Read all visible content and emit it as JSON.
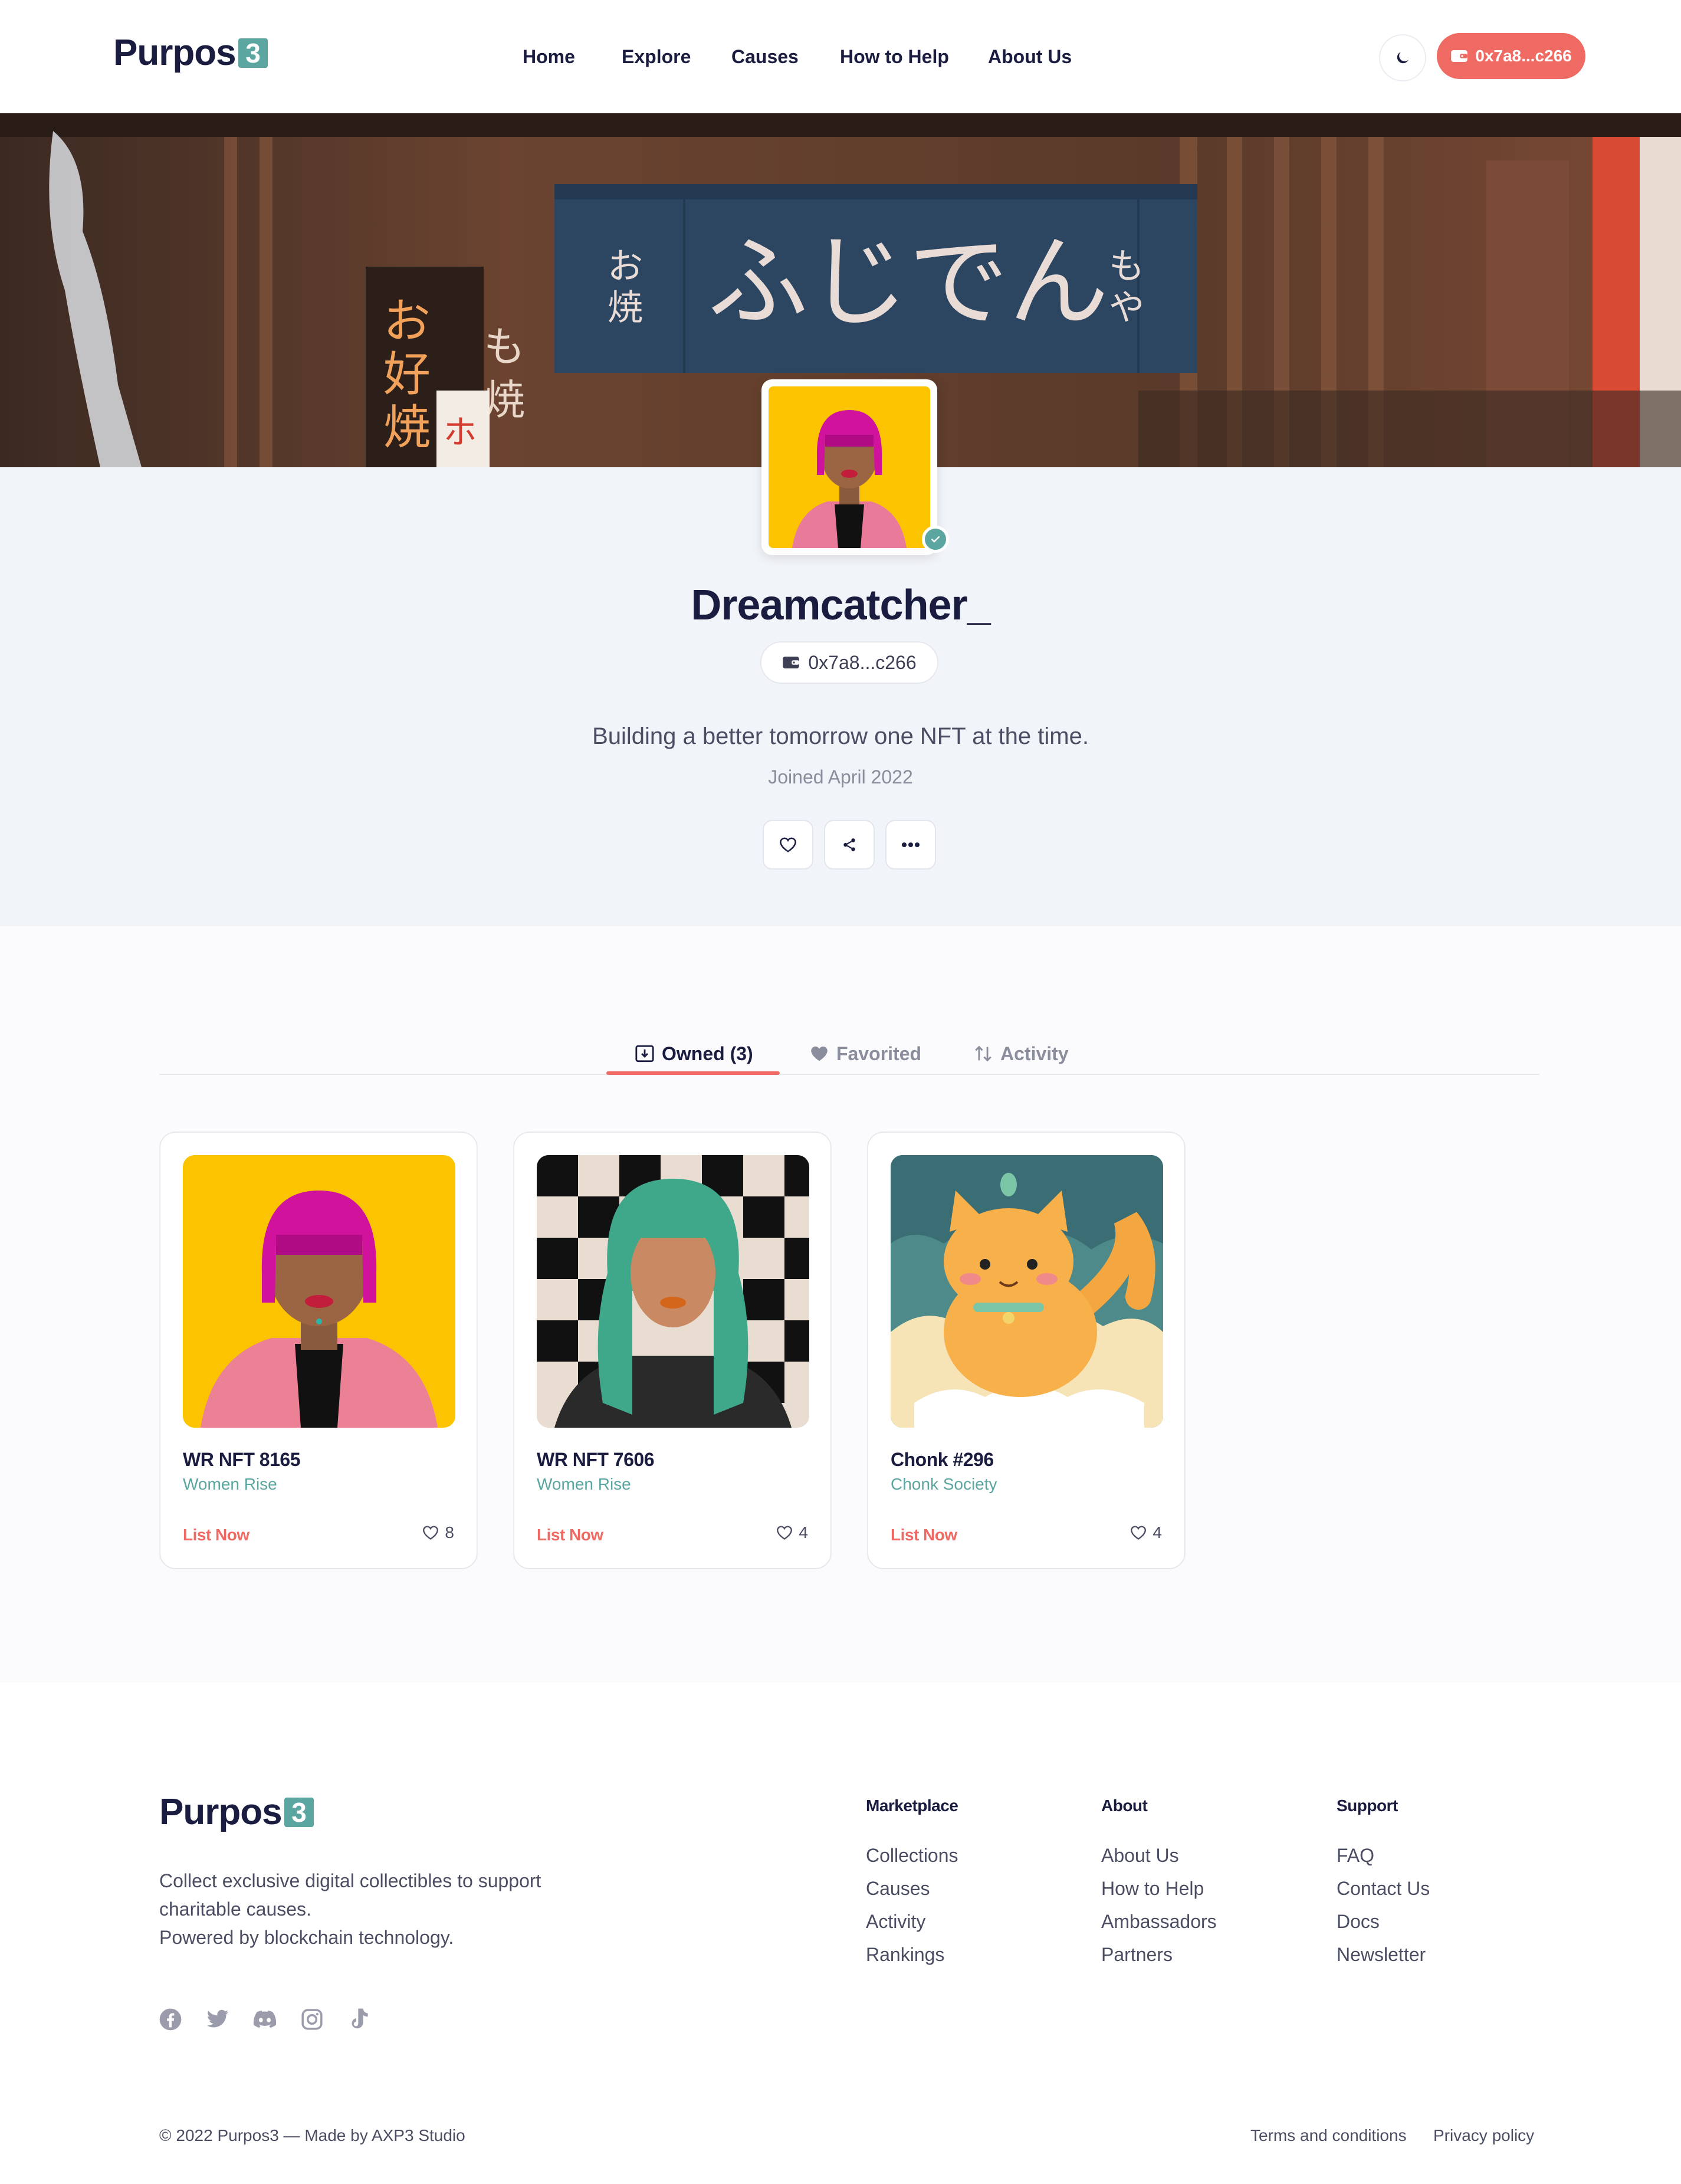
{
  "header": {
    "logo_text": "Purpos",
    "logo_accent": "3",
    "nav": [
      "Home",
      "Explore",
      "Causes",
      "How to Help",
      "About Us"
    ],
    "wallet_label": "0x7a8...c266"
  },
  "profile": {
    "username": "Dreamcatcher_",
    "address": "0x7a8...c266",
    "bio": "Building a better tomorrow one NFT at the time.",
    "joined": "Joined April 2022"
  },
  "tabs": [
    {
      "label": "Owned (3)",
      "active": true
    },
    {
      "label": "Favorited",
      "active": false
    },
    {
      "label": "Activity",
      "active": false
    }
  ],
  "cards": [
    {
      "name": "WR NFT 8165",
      "collection": "Women Rise",
      "action": "List Now",
      "likes": "8"
    },
    {
      "name": "WR NFT 7606",
      "collection": "Women Rise",
      "action": "List Now",
      "likes": "4"
    },
    {
      "name": "Chonk #296",
      "collection": "Chonk Society",
      "action": "List Now",
      "likes": "4"
    }
  ],
  "footer": {
    "logo_text": "Purpos",
    "logo_accent": "3",
    "desc_line1": "Collect exclusive digital collectibles to support",
    "desc_line2": "charitable causes.",
    "desc_line3": "Powered by blockchain technology.",
    "social_icons": [
      "facebook-icon",
      "twitter-icon",
      "discord-icon",
      "instagram-icon",
      "tiktok-icon"
    ],
    "columns": [
      {
        "title": "Marketplace",
        "links": [
          "Collections",
          "Causes",
          "Activity",
          "Rankings"
        ]
      },
      {
        "title": "About",
        "links": [
          "About Us",
          "How to Help",
          "Ambassadors",
          "Partners"
        ]
      },
      {
        "title": "Support",
        "links": [
          "FAQ",
          "Contact Us",
          "Docs",
          "Newsletter"
        ]
      }
    ],
    "copyright": "© 2022 Purpos3 — Made by AXP3 Studio",
    "terms": "Terms and conditions",
    "privacy": "Privacy policy"
  },
  "colors": {
    "accent": "#ef6a62",
    "brand_teal": "#5ba6a0",
    "navy": "#1b1d40"
  }
}
